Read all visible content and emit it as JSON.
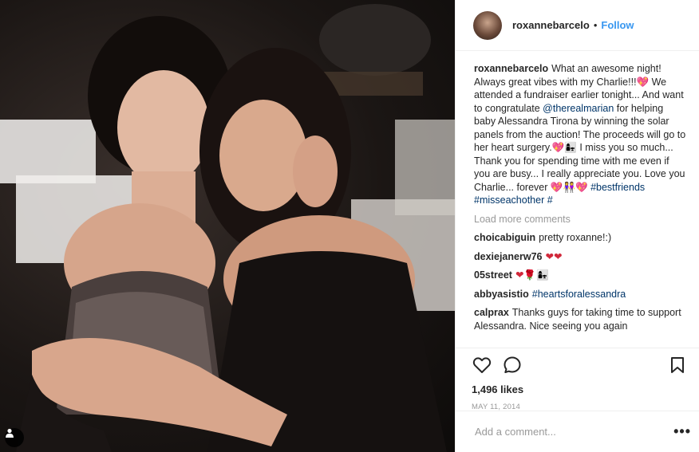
{
  "post": {
    "username": "roxannebarcelo",
    "follow_label": "Follow",
    "separator": "•",
    "caption": {
      "username": "roxannebarcelo",
      "text_1": "What an awesome night! Always great vibes with my Charlie!!!",
      "emoji_1": "💖",
      "text_2": " We attended a fundraiser earlier tonight... And want to congratulate ",
      "mention": "@therealmarian",
      "text_3": " for helping baby Alessandra Tirona by winning the solar panels from the auction! The proceeds will go to her heart surgery.",
      "emoji_2": "💖👩‍👧",
      "text_4": " I miss you so much... Thank you for spending time with me even if you are busy... I really appreciate you. Love you Charlie... forever ",
      "emoji_3": "💖👭💖",
      "hashtag_1": "#bestfriends",
      "hashtag_2": "#misseachother",
      "hashtag_3": "#"
    },
    "load_more_label": "Load more comments",
    "comments": [
      {
        "username": "choicabiguin",
        "text": "pretty roxanne!:)"
      },
      {
        "username": "dexiejanerw76",
        "text": "❤❤"
      },
      {
        "username": "05street",
        "text": "❤🌹👩‍👧"
      },
      {
        "username": "abbyasistio",
        "text": "#heartsforalessandra"
      },
      {
        "username": "calprax",
        "text": "Thanks guys for taking time to support Alessandra. Nice seeing you again"
      }
    ],
    "likes": "1,496 likes",
    "date": "MAY 11, 2014",
    "add_comment_placeholder": "Add a comment...",
    "more_options_label": "•••"
  },
  "icons": {
    "like": "heart-icon",
    "comment": "comment-icon",
    "save": "bookmark-icon",
    "user_tag": "user-tag-icon",
    "more": "more-options-icon"
  }
}
